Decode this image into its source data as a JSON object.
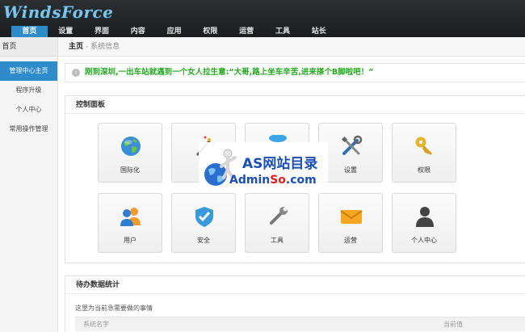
{
  "header": {
    "logo": "WindsForce"
  },
  "nav": [
    "首页",
    "设置",
    "界面",
    "内容",
    "应用",
    "权限",
    "运营",
    "工具",
    "站长"
  ],
  "sidebar": {
    "top_cut": "ｹ",
    "home": "首页",
    "items": [
      "管理中心主页",
      "程序升级",
      "个人中心",
      "常用操作管理"
    ]
  },
  "breadcrumb": {
    "home": "主页",
    "sep": "-",
    "current": "系统信息"
  },
  "notice": {
    "icon": "info-icon",
    "text": "刚到深圳,一出车站就遇到一个女人拉生意:“大哥,路上坐车辛苦,进来搽个B脚啦吧！”"
  },
  "control_panel": {
    "title": "控制面板",
    "tiles": [
      {
        "label": "国际化",
        "icon": "globe-icon"
      },
      {
        "label": "主",
        "icon": "wand-icon"
      },
      {
        "label": "",
        "icon": "bubble-icon"
      },
      {
        "label": "设置",
        "icon": "tools-icon"
      },
      {
        "label": "权限",
        "icon": "key-icon"
      },
      {
        "label": "用户",
        "icon": "users-icon"
      },
      {
        "label": "安全",
        "icon": "shield-icon"
      },
      {
        "label": "工具",
        "icon": "wrench-icon"
      },
      {
        "label": "运营",
        "icon": "envelope-icon"
      },
      {
        "label": "个人中心",
        "icon": "person-icon"
      }
    ]
  },
  "stats": {
    "title": "待办数据统计",
    "desc": "这里为当前急需要做的事情",
    "col1": "系统名字",
    "col2": "当前值"
  },
  "watermark": {
    "line1": "AS网站目录",
    "line2a": "Admin",
    "line2b": "So",
    "line2c": ".com"
  },
  "colors": {
    "accent": "#2f8bc9",
    "notice": "#22a81e",
    "watermark_blue": "#1a4fb5",
    "watermark_red": "#e01e1e"
  }
}
